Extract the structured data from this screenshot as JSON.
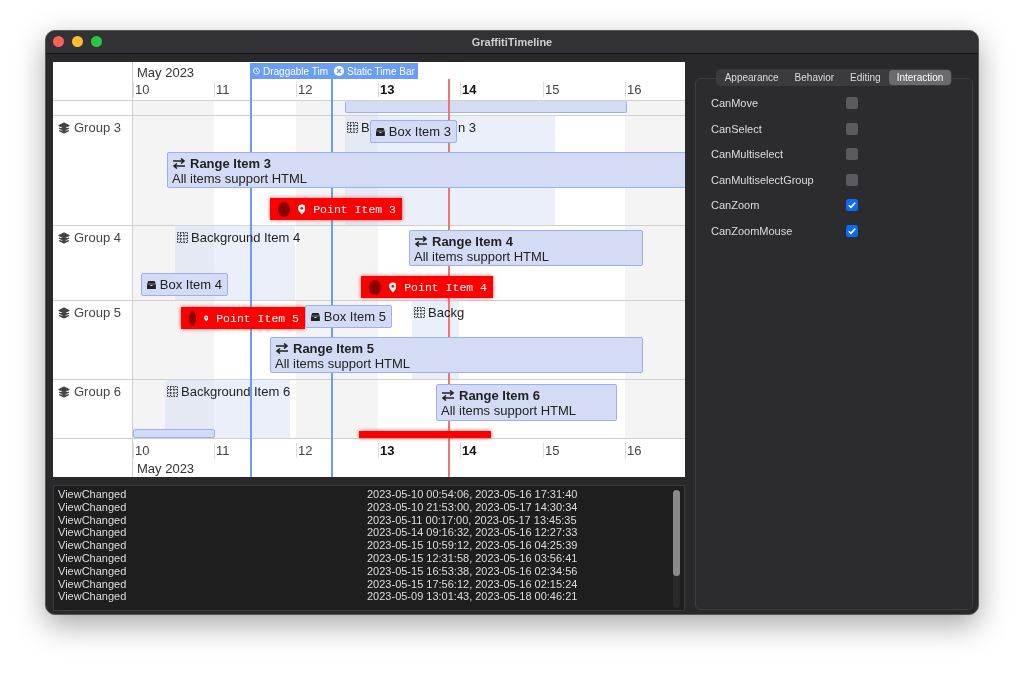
{
  "window": {
    "title": "GraffitiTimeline"
  },
  "timeline": {
    "month_top": "May 2023",
    "month_bottom": "May 2023",
    "days_top": [
      {
        "label": "10",
        "bold": false
      },
      {
        "label": "11",
        "bold": false
      },
      {
        "label": "12",
        "bold": false
      },
      {
        "label": "13",
        "bold": true
      },
      {
        "label": "14",
        "bold": true
      },
      {
        "label": "15",
        "bold": false
      },
      {
        "label": "16",
        "bold": false
      }
    ],
    "days_bottom": [
      {
        "label": "10",
        "bold": false
      },
      {
        "label": "11",
        "bold": false
      },
      {
        "label": "12",
        "bold": false
      },
      {
        "label": "13",
        "bold": true
      },
      {
        "label": "14",
        "bold": true
      },
      {
        "label": "15",
        "bold": false
      },
      {
        "label": "16",
        "bold": false
      }
    ],
    "time_bars": [
      {
        "kind": "draggable",
        "label": "Draggable Tim"
      },
      {
        "kind": "static",
        "label": "Static Time Bar"
      },
      {
        "kind": "current"
      }
    ],
    "groups": [
      {
        "label": "Group 3",
        "items": [
          {
            "kind": "background",
            "label": "B",
            "label_end": "n 3"
          },
          {
            "kind": "box",
            "label": "Box Item 3"
          },
          {
            "kind": "range",
            "label": "Range Item 3",
            "subtitle": "All items support HTML"
          },
          {
            "kind": "point",
            "label": "Point Item 3"
          }
        ]
      },
      {
        "label": "Group 4",
        "items": [
          {
            "kind": "background",
            "label": "Background Item 4"
          },
          {
            "kind": "range",
            "label": "Range Item 4",
            "subtitle": "All items support HTML"
          },
          {
            "kind": "box",
            "label": "Box Item 4"
          },
          {
            "kind": "point",
            "label": "Point Item 4"
          }
        ]
      },
      {
        "label": "Group 5",
        "items": [
          {
            "kind": "point",
            "label": "Point Item 5"
          },
          {
            "kind": "box",
            "label": "Box Item 5"
          },
          {
            "kind": "background",
            "label": "Backg"
          },
          {
            "kind": "range",
            "label": "Range Item 5",
            "subtitle": "All items support HTML"
          }
        ]
      },
      {
        "label": "Group 6",
        "items": [
          {
            "kind": "background",
            "label": "Background Item 6"
          },
          {
            "kind": "range",
            "label": "Range Item 6",
            "subtitle": "All items support HTML"
          }
        ]
      }
    ]
  },
  "log": [
    {
      "event": "ViewChanged",
      "detail": "2023-05-10 00:54:06, 2023-05-16 17:31:40"
    },
    {
      "event": "ViewChanged",
      "detail": "2023-05-10 21:53:00, 2023-05-17 14:30:34"
    },
    {
      "event": "ViewChanged",
      "detail": "2023-05-11 00:17:00, 2023-05-17 13:45:35"
    },
    {
      "event": "ViewChanged",
      "detail": "2023-05-14 09:16:32, 2023-05-16 12:27:33"
    },
    {
      "event": "ViewChanged",
      "detail": "2023-05-15 10:59:12, 2023-05-16 04:25:39"
    },
    {
      "event": "ViewChanged",
      "detail": "2023-05-15 12:31:58, 2023-05-16 03:56:41"
    },
    {
      "event": "ViewChanged",
      "detail": "2023-05-15 16:53:38, 2023-05-16 02:34:56"
    },
    {
      "event": "ViewChanged",
      "detail": "2023-05-15 17:56:12, 2023-05-16 02:15:24"
    },
    {
      "event": "ViewChanged",
      "detail": "2023-05-09 13:01:43, 2023-05-18 00:46:21"
    }
  ],
  "settings": {
    "tabs": [
      {
        "label": "Appearance",
        "selected": false
      },
      {
        "label": "Behavior",
        "selected": false
      },
      {
        "label": "Editing",
        "selected": false
      },
      {
        "label": "Interaction",
        "selected": true
      }
    ],
    "options": [
      {
        "label": "CanMove",
        "checked": false
      },
      {
        "label": "CanSelect",
        "checked": false
      },
      {
        "label": "CanMultiselect",
        "checked": false
      },
      {
        "label": "CanMultiselectGroup",
        "checked": false
      },
      {
        "label": "CanZoom",
        "checked": true
      },
      {
        "label": "CanZoomMouse",
        "checked": true
      }
    ]
  }
}
